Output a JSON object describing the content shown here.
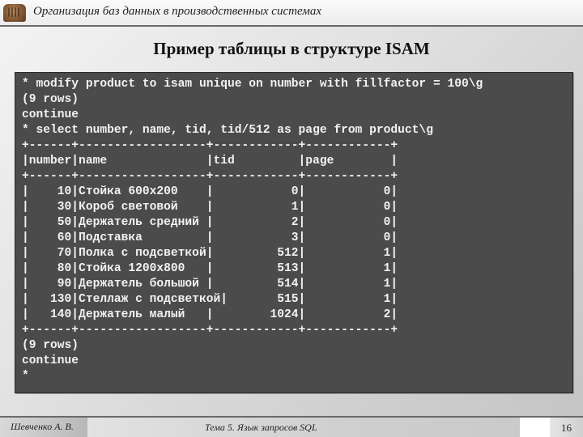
{
  "header": {
    "logo_icon": "building-logo-icon",
    "course_title": "Организация баз данных в производственных системах"
  },
  "slide": {
    "title": "Пример таблицы в структуре ISAM"
  },
  "terminal": {
    "lines": [
      "* modify product to isam unique on number with fillfactor = 100\\g",
      "(9 rows)",
      "continue",
      "* select number, name, tid, tid/512 as page from product\\g",
      "+------+------------------+------------+------------+",
      "|number|name              |tid         |page        |",
      "+------+------------------+------------+------------+",
      "|    10|Стойка 600x200    |           0|           0|",
      "|    30|Короб световой    |           1|           0|",
      "|    50|Держатель средний |           2|           0|",
      "|    60|Подставка         |           3|           0|",
      "|    70|Полка с подсветкой|         512|           1|",
      "|    80|Стойка 1200x800   |         513|           1|",
      "|    90|Держатель большой |         514|           1|",
      "|   130|Стеллаж с подсветкой|       515|           1|",
      "|   140|Держатель малый   |        1024|           2|",
      "+------+------------------+------------+------------+",
      "(9 rows)",
      "continue",
      "*"
    ],
    "result_table": {
      "columns": [
        "number",
        "name",
        "tid",
        "page"
      ],
      "rows": [
        [
          "10",
          "Стойка 600x200",
          "0",
          "0"
        ],
        [
          "30",
          "Короб световой",
          "1",
          "0"
        ],
        [
          "50",
          "Держатель средний",
          "2",
          "0"
        ],
        [
          "60",
          "Подставка",
          "3",
          "0"
        ],
        [
          "70",
          "Полка с подсветкой",
          "512",
          "1"
        ],
        [
          "80",
          "Стойка 1200x800",
          "513",
          "1"
        ],
        [
          "90",
          "Держатель большой",
          "514",
          "1"
        ],
        [
          "130",
          "Стеллаж с подсветкой",
          "515",
          "1"
        ],
        [
          "140",
          "Держатель малый",
          "1024",
          "2"
        ]
      ]
    }
  },
  "footer": {
    "author": "Шевченко А. В.",
    "topic": "Тема 5. Язык запросов SQL",
    "page_number": "16"
  }
}
